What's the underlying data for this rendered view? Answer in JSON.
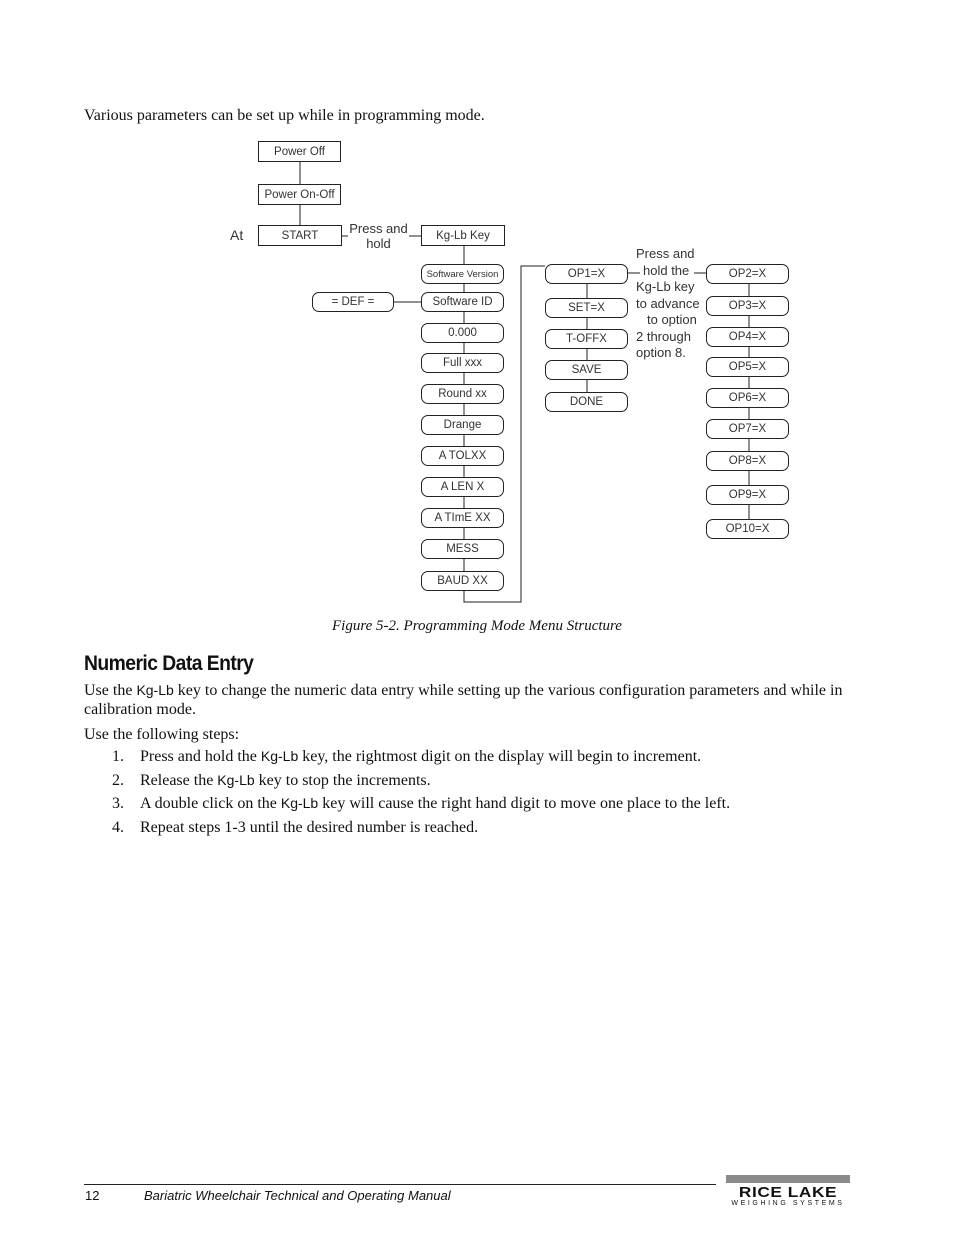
{
  "intro_text": "Various parameters can be set up while in programming mode.",
  "diagram": {
    "power_off": "Power Off",
    "power_on_off": "Power On-Off",
    "at_label": "At",
    "start": "START",
    "press_hold": [
      "Press and",
      "hold"
    ],
    "kg_lb_key": "Kg-Lb Key",
    "def": "= DEF =",
    "main_menu": [
      "Software Version",
      "Software ID",
      "0.000",
      "Full xxx",
      "Round xx",
      "Drange",
      "A TOLXX",
      "A LEN X",
      "A TImE XX",
      "MESS",
      "BAUD XX"
    ],
    "op_menu": [
      "OP1=X",
      "SET=X",
      "T-OFFX",
      "SAVE",
      "DONE"
    ],
    "advance_note": [
      "Press and",
      "hold the",
      "Kg-Lb key",
      "to advance",
      "to option",
      "2 through",
      "option 8."
    ],
    "options": [
      "OP2=X",
      "OP3=X",
      "OP4=X",
      "OP5=X",
      "OP6=X",
      "OP7=X",
      "OP8=X",
      "OP9=X",
      "OP10=X"
    ]
  },
  "caption": "Figure 5-2. Programming Mode Menu Structure",
  "section": {
    "title": "Numeric Data Entry",
    "para1_before": "Use the ",
    "para1_key": "Kg-Lb",
    "para1_after": " key to change the numeric data entry while setting up the various configuration parameters and while in calibration mode.",
    "para2": "Use the following steps:",
    "steps": [
      {
        "num": "1.",
        "before": "Press and hold the ",
        "key": "Kg-Lb",
        "after": " key, the rightmost digit on the display will begin to increment."
      },
      {
        "num": "2.",
        "before": "Release the ",
        "key": "Kg-Lb",
        "after": " key to stop the increments."
      },
      {
        "num": "3.",
        "before": "A double click on the ",
        "key": "Kg-Lb",
        "after": " key will cause the right hand digit to move one place to the left."
      },
      {
        "num": "4.",
        "before": "Repeat steps 1-3 until the desired number is reached.",
        "key": "",
        "after": ""
      }
    ]
  },
  "footer": {
    "page_number": "12",
    "manual_title": "Bariatric Wheelchair Technical and Operating Manual",
    "logo_main": "RICE LAKE",
    "logo_sub": "WEIGHING SYSTEMS"
  }
}
